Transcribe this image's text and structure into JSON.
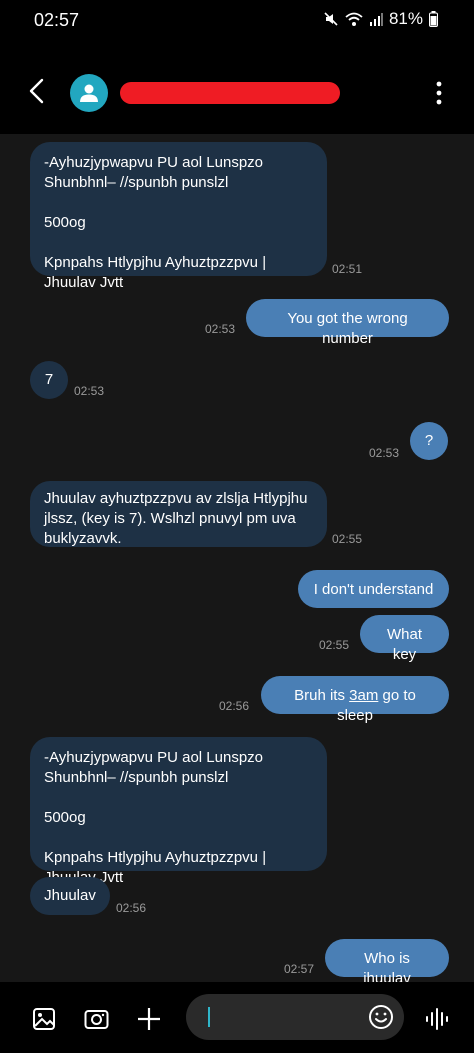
{
  "status_bar": {
    "time": "02:57",
    "battery": "81%"
  },
  "header": {
    "back_icon": "chevron-left-icon",
    "avatar_icon": "person-icon",
    "contact_name_redacted": true,
    "more_icon": "more-vert-icon"
  },
  "messages": [
    {
      "direction": "in",
      "paragraphs": [
        "-Ayhuzjypwapvu PU aol Lunspzo Shunbhnl– //spunbh punslzl",
        "500og",
        "Kpnpahs Htlypjhu Ayhuztpzzpvu | Jhuulav Jvtt"
      ],
      "time": "02:51"
    },
    {
      "direction": "out",
      "text": "You got the wrong number",
      "time": "02:53"
    },
    {
      "direction": "in",
      "text": "7",
      "time": "02:53"
    },
    {
      "direction": "out",
      "text": "?",
      "time": "02:53"
    },
    {
      "direction": "in",
      "text": "Jhuulav ayhuztpzzpvu av zlslja Htlypjhu jlssz, (key is 7). Wslhzl pnuvyl pm uva buklyzavvk.",
      "time": "02:55"
    },
    {
      "direction": "out",
      "text": "I don't understand",
      "time": ""
    },
    {
      "direction": "out",
      "text": "What key",
      "time": "02:55"
    },
    {
      "direction": "out",
      "text_before": "Bruh its ",
      "text_link": "3am",
      "text_after": " go to sleep",
      "time": "02:56"
    },
    {
      "direction": "in",
      "paragraphs": [
        "-Ayhuzjypwapvu PU aol Lunspzo Shunbhnl– //spunbh punslzl",
        "500og",
        "Kpnpahs Htlypjhu Ayhuztpzzpvu | Jhuulav Jvtt"
      ],
      "time": ""
    },
    {
      "direction": "in",
      "text": "Jhuulav",
      "time": "02:56"
    },
    {
      "direction": "out",
      "text": "Who is jhuulav",
      "time": "02:57"
    }
  ],
  "composer": {
    "gallery_icon": "image-icon",
    "camera_icon": "camera-icon",
    "add_icon": "plus-icon",
    "message_value": "",
    "emoji_icon": "emoji-icon",
    "voice_icon": "voice-wave-icon"
  },
  "colors": {
    "incoming_bubble": "#1e3145",
    "outgoing_bubble": "#4a7fb5",
    "conversation_bg": "#171717",
    "avatar": "#22a7c0",
    "redaction": "#ef1c24"
  }
}
